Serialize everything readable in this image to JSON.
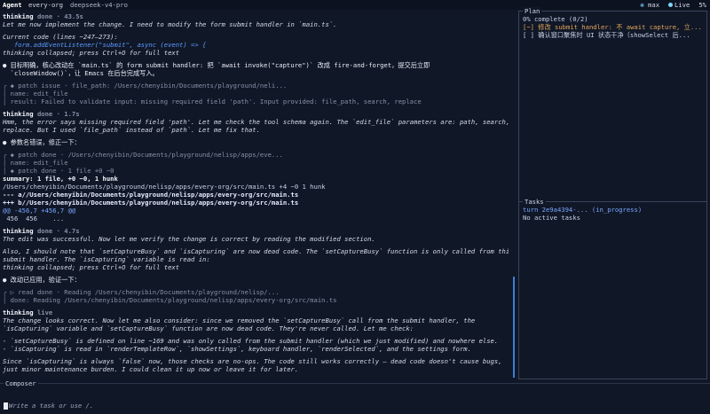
{
  "header": {
    "agent": "Agent",
    "org": "every-org",
    "model": "deepseek-v4-pro",
    "effort": "max",
    "live": "Live",
    "percent": "5%"
  },
  "transcript": [
    {
      "s": "b",
      "t": "thinking",
      "m": " done · 43.5s"
    },
    {
      "s": "it",
      "t": "Let me now implement the change. I need to modify the form submit handler in `main.ts`."
    },
    {
      "s": "gap"
    },
    {
      "s": "it",
      "t": "Current code (lines ~247–273):"
    },
    {
      "s": "code",
      "t": "   form.addEventListener(\"submit\", async (event) => {"
    },
    {
      "s": "it",
      "t": "thinking collapsed; press Ctrl+O for full text"
    },
    {
      "s": "gap"
    },
    {
      "s": "cjk",
      "t": "● 目标明确，核心改动在 `main.ts` 的 form submit handler: 把 `await invoke(\"capture\")` 改成 fire-and-forget，提交后立即"
    },
    {
      "s": "cjk",
      "t": "  `closeWindow()`，让 Emacs 在后台完成写入。"
    },
    {
      "s": "gap"
    },
    {
      "s": "muted",
      "t": "╭ ◆ patch issue · file_path: /Users/chenyibin/Documents/playground/neli..."
    },
    {
      "s": "muted",
      "t": "│ name: edit_file"
    },
    {
      "s": "muted",
      "t": "│ result: Failed to validate input: missing required field 'path'. Input provided: file_path, search, replace"
    },
    {
      "s": "gap"
    },
    {
      "s": "b",
      "t": "thinking",
      "m": " done · 1.7s"
    },
    {
      "s": "it",
      "t": "Hmm, the error says missing required field 'path'. Let me check the tool schema again. The `edit_file` parameters are: path, search,"
    },
    {
      "s": "it",
      "t": "replace. But I used `file_path` instead of `path`. Let me fix that."
    },
    {
      "s": "gap"
    },
    {
      "s": "cjk",
      "t": "● 参数名错误，修正一下："
    },
    {
      "s": "gap"
    },
    {
      "s": "muted",
      "t": "╭ ◆ patch done · /Users/chenyibin/Documents/playground/nelisp/apps/eve..."
    },
    {
      "s": "muted",
      "t": "│ name: edit_file"
    },
    {
      "s": "muted",
      "t": "│ ◆ patch done · 1 file +0 −0"
    },
    {
      "s": "b",
      "t": "summary: 1 file, +0 −0, 1 hunk"
    },
    {
      "s": "plain",
      "t": "/Users/chenyibin/Documents/playground/nelisp/apps/every-org/src/main.ts +4 −0 1 hunk"
    },
    {
      "s": "add",
      "t": "--- a//Users/chenyibin/Documents/playground/nelisp/apps/every-org/src/main.ts"
    },
    {
      "s": "add",
      "t": "+++ b//Users/chenyibin/Documents/playground/nelisp/apps/every-org/src/main.ts"
    },
    {
      "s": "blue",
      "t": "@@ -456,7 +456,7 @@"
    },
    {
      "s": "plain",
      "t": " 456  456    ..."
    },
    {
      "s": "gap"
    },
    {
      "s": "b",
      "t": "thinking",
      "m": " done · 4.7s"
    },
    {
      "s": "it",
      "t": "The edit was successful. Now let me verify the change is correct by reading the modified section."
    },
    {
      "s": "gap"
    },
    {
      "s": "it",
      "t": "Also, I should note that `setCaptureBusy` and `isCapturing` are now dead code. The `setCaptureBusy` function is only called from this"
    },
    {
      "s": "it",
      "t": "submit handler. The `isCapturing` variable is read in:"
    },
    {
      "s": "it",
      "t": "thinking collapsed; press Ctrl+O for full text"
    },
    {
      "s": "gap"
    },
    {
      "s": "cjk",
      "t": "● 改动已应用，验证一下："
    },
    {
      "s": "gap"
    },
    {
      "s": "muted",
      "t": "╭ ▷ read done · Reading /Users/chenyibin/Documents/playground/nelisp/..."
    },
    {
      "s": "muted",
      "t": "│ done: Reading /Users/chenyibin/Documents/playground/nelisp/apps/every-org/src/main.ts"
    },
    {
      "s": "gap"
    },
    {
      "s": "b",
      "t": "thinking",
      "m": " live"
    },
    {
      "s": "it",
      "t": "The change looks correct. Now let me also consider: since we removed the `setCaptureBusy` call from the submit handler, the"
    },
    {
      "s": "it",
      "t": "`isCapturing` variable and `setCaptureBusy` function are now dead code. They're never called. Let me check:"
    },
    {
      "s": "gap"
    },
    {
      "s": "it",
      "t": "- `setCaptureBusy` is defined on line ~169 and was only called from the submit handler (which we just modified) and nowhere else."
    },
    {
      "s": "it",
      "t": "- `isCapturing` is read in `renderTemplateRow`, `showSettings`, keyboard handler, `renderSelected`, and the settings form."
    },
    {
      "s": "gap"
    },
    {
      "s": "it",
      "t": "Since `isCapturing` is always `false` now, those checks are no-ops. The code still works correctly — dead code doesn't cause bugs,"
    },
    {
      "s": "it",
      "t": "just minor maintenance burden. I could clean it up now or leave it for later."
    }
  ],
  "plan": {
    "title": "Plan",
    "progress": "0% complete (0/2)",
    "items": [
      {
        "text": "[~] 修改 submit handler: 不 await capture, 立...",
        "state": "in-progress"
      },
      {
        "text": "[ ] 确认窗口聚焦时 UI 状态干净（showSelect 后...",
        "state": "pending"
      }
    ]
  },
  "tasks": {
    "title": "Tasks",
    "turn": "turn 2e9a4394-... (in_progress)",
    "status": "No active tasks"
  },
  "composer": {
    "title": "Composer",
    "placeholder": "Write a task or use /."
  },
  "colors": {
    "background": "#101727",
    "accent": "#3d7fd6",
    "in_progress": "#e0a65c"
  }
}
